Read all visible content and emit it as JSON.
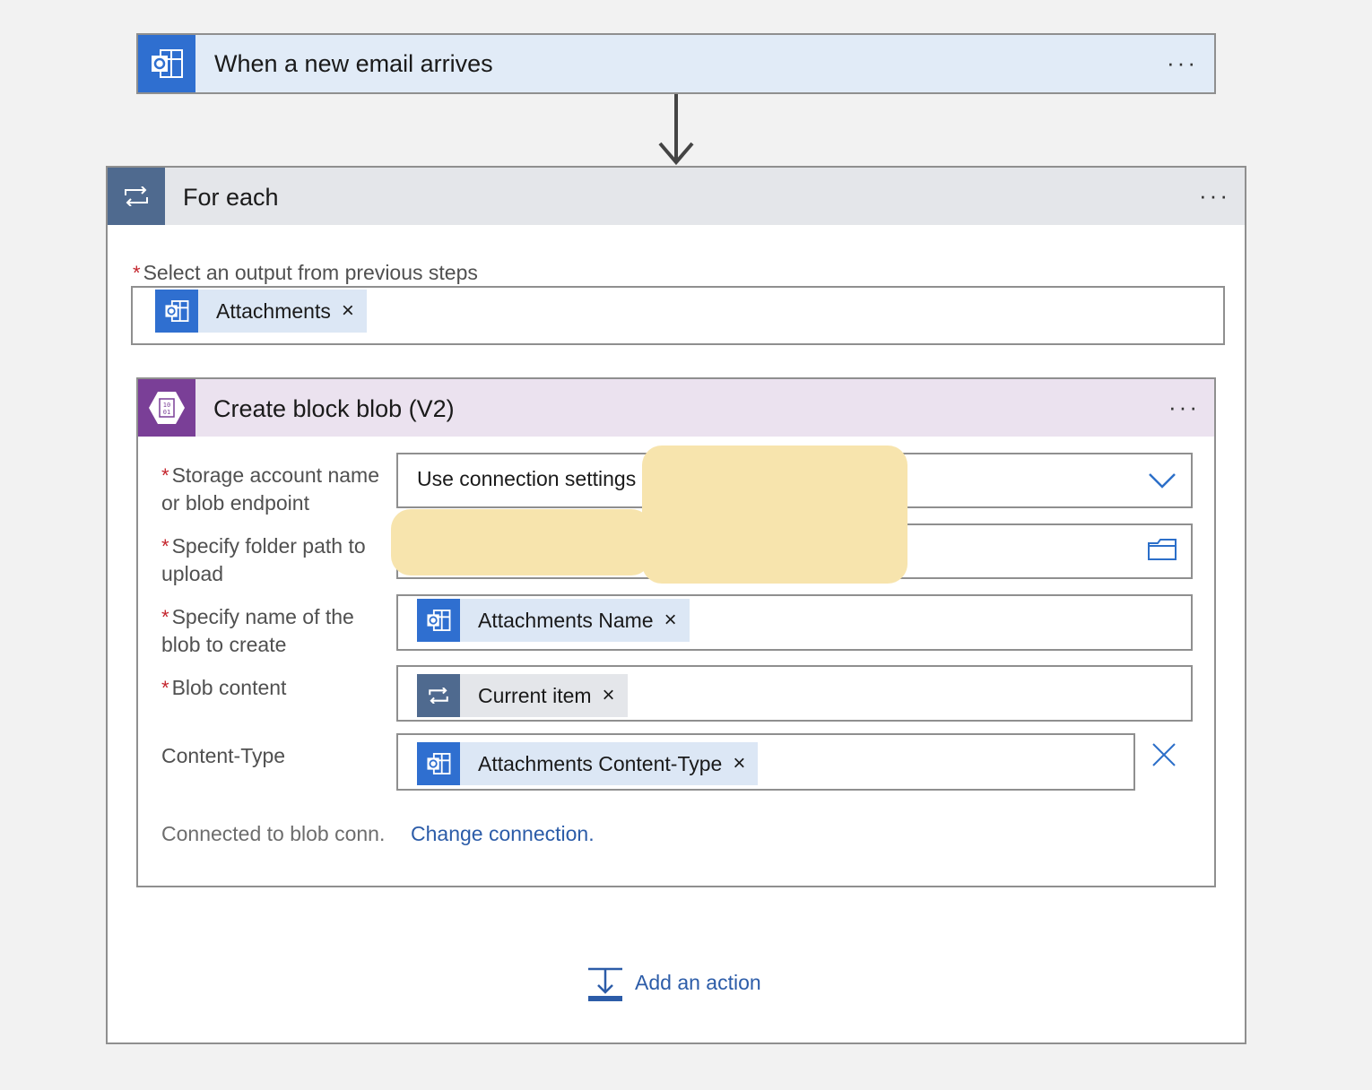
{
  "trigger": {
    "title": "When a new email arrives",
    "icon": "outlook-icon",
    "more": "···"
  },
  "foreach": {
    "title": "For each",
    "icon": "loop-icon",
    "more": "···",
    "required_mark": "*",
    "select_label": "Select an output from previous steps",
    "select_token": {
      "label": "Attachments",
      "icon": "outlook-icon",
      "remove": "×"
    }
  },
  "blob": {
    "title": "Create block blob (V2)",
    "icon": "blob-storage-icon",
    "more": "···",
    "fields": {
      "storage": {
        "label_line1": "Storage account name",
        "label_line2": "or blob endpoint",
        "value": "Use connection settings"
      },
      "folder": {
        "label_line1": "Specify folder path to",
        "label_line2": "upload"
      },
      "name": {
        "label_line1": "Specify name of the",
        "label_line2": "blob to create",
        "token": "Attachments Name",
        "remove": "×"
      },
      "content": {
        "label": "Blob content",
        "token": "Current item",
        "remove": "×"
      },
      "content_type": {
        "label": "Content-Type",
        "token": "Attachments Content-Type",
        "remove": "×"
      }
    },
    "connected_text": "Connected to blob conn.",
    "change_connection": "Change connection."
  },
  "add_action": "Add an action",
  "colors": {
    "outlook": "#2f6fd0",
    "loop": "#4f6a8f",
    "blob": "#7a3f97",
    "link": "#2c5ca8",
    "required": "#c4242c"
  }
}
